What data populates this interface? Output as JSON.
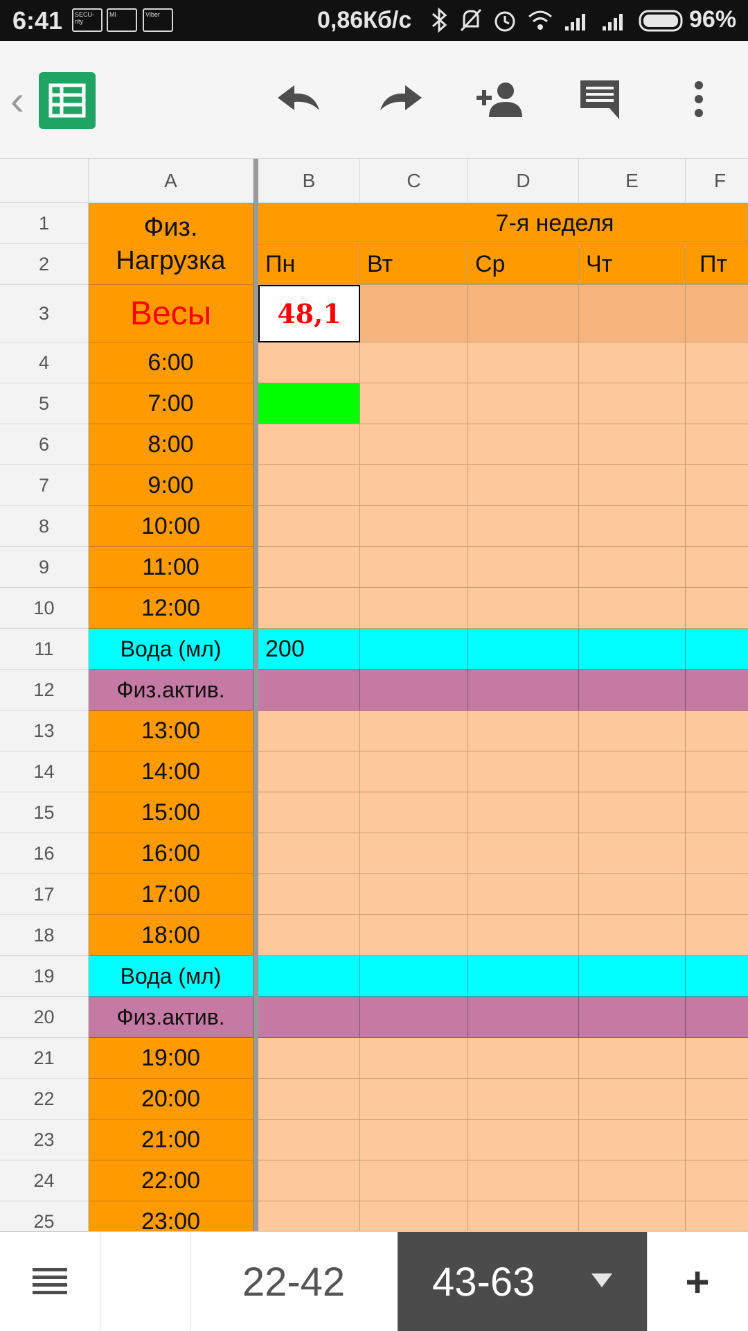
{
  "status_bar": {
    "time": "6:41",
    "notifications": [
      "SECU-rity",
      "MI",
      "Viber"
    ],
    "net_speed": "0,86Кб/с",
    "battery": "96%"
  },
  "toolbar": {
    "back_glyph": "‹",
    "app_icon": "google-sheets-icon",
    "actions": [
      "undo-icon",
      "redo-icon",
      "add-person-icon",
      "comment-icon",
      "more-vert-icon"
    ]
  },
  "grid": {
    "columns": [
      "A",
      "B",
      "C",
      "D",
      "E",
      "F"
    ],
    "merged_header": "7-я неделя",
    "day_headers": [
      "Пн",
      "Вт",
      "Ср",
      "Чт",
      "Пт"
    ],
    "a1_label": "Физ.\nНагрузка",
    "weight_label": "Весы",
    "weight_value": "48,1",
    "rows": [
      {
        "num": "4",
        "label": "6:00",
        "kind": "time"
      },
      {
        "num": "5",
        "label": "7:00",
        "kind": "time",
        "b_green": true
      },
      {
        "num": "6",
        "label": "8:00",
        "kind": "time"
      },
      {
        "num": "7",
        "label": "9:00",
        "kind": "time"
      },
      {
        "num": "8",
        "label": "10:00",
        "kind": "time"
      },
      {
        "num": "9",
        "label": "11:00",
        "kind": "time"
      },
      {
        "num": "10",
        "label": "12:00",
        "kind": "time"
      },
      {
        "num": "11",
        "label": "Вода (мл)",
        "kind": "water",
        "b_value": "200"
      },
      {
        "num": "12",
        "label": "Физ.актив.",
        "kind": "activity"
      },
      {
        "num": "13",
        "label": "13:00",
        "kind": "time"
      },
      {
        "num": "14",
        "label": "14:00",
        "kind": "time"
      },
      {
        "num": "15",
        "label": "15:00",
        "kind": "time"
      },
      {
        "num": "16",
        "label": "16:00",
        "kind": "time"
      },
      {
        "num": "17",
        "label": "17:00",
        "kind": "time"
      },
      {
        "num": "18",
        "label": "18:00",
        "kind": "time"
      },
      {
        "num": "19",
        "label": "Вода (мл)",
        "kind": "water"
      },
      {
        "num": "20",
        "label": "Физ.актив.",
        "kind": "activity"
      },
      {
        "num": "21",
        "label": "19:00",
        "kind": "time"
      },
      {
        "num": "22",
        "label": "20:00",
        "kind": "time"
      },
      {
        "num": "23",
        "label": "21:00",
        "kind": "time"
      },
      {
        "num": "24",
        "label": "22:00",
        "kind": "time"
      },
      {
        "num": "25",
        "label": "23:00",
        "kind": "time"
      }
    ],
    "colors": {
      "orange": "#ff9b00",
      "peach": "#fdc89a",
      "peach_dark": "#f5b57c",
      "cyan": "#00ffff",
      "purple": "#c47aa2",
      "green": "#00ff00",
      "weight_red": "#ff0000"
    }
  },
  "sheet_tabs": {
    "menu_icon": "sheets-list-icon",
    "tabs": [
      "22-42",
      "43-63"
    ],
    "active_index": 1,
    "add_label": "+"
  }
}
